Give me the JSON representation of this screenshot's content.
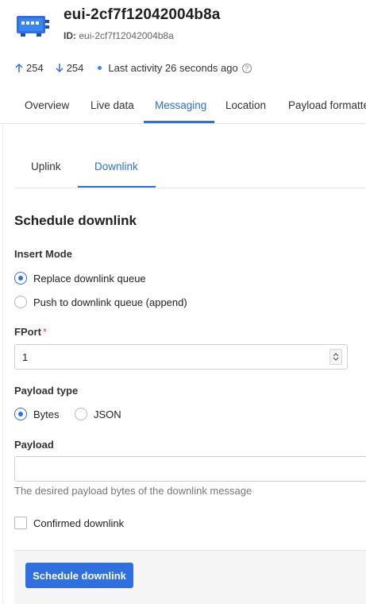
{
  "header": {
    "title": "eui-2cf7f12042004b8a",
    "id_label": "ID:",
    "id_value": "eui-2cf7f12042004b8a",
    "device_icon": "device-icon"
  },
  "stats": {
    "uplink_count": "254",
    "downlink_count": "254",
    "last_activity": "Last activity 26 seconds ago",
    "help_icon": "?"
  },
  "main_tabs": [
    {
      "label": "Overview"
    },
    {
      "label": "Live data"
    },
    {
      "label": "Messaging",
      "active": true
    },
    {
      "label": "Location"
    },
    {
      "label": "Payload formatte"
    }
  ],
  "sub_tabs": [
    {
      "label": "Uplink"
    },
    {
      "label": "Downlink",
      "active": true
    }
  ],
  "form": {
    "section_title": "Schedule downlink",
    "insert_mode_label": "Insert Mode",
    "insert_mode_options": [
      {
        "label": "Replace downlink queue",
        "checked": true
      },
      {
        "label": "Push to downlink queue (append)",
        "checked": false
      }
    ],
    "fport_label": "FPort",
    "fport_required_mark": "*",
    "fport_value": "1",
    "payload_type_label": "Payload type",
    "payload_type_options": [
      {
        "label": "Bytes",
        "checked": true
      },
      {
        "label": "JSON",
        "checked": false
      }
    ],
    "payload_label": "Payload",
    "payload_value": "",
    "payload_hint": "The desired payload bytes of the downlink message",
    "confirmed_label": "Confirmed downlink",
    "confirmed_checked": false,
    "submit_label": "Schedule downlink"
  },
  "colors": {
    "accent": "#2f6fe0",
    "required": "#e5484d"
  }
}
